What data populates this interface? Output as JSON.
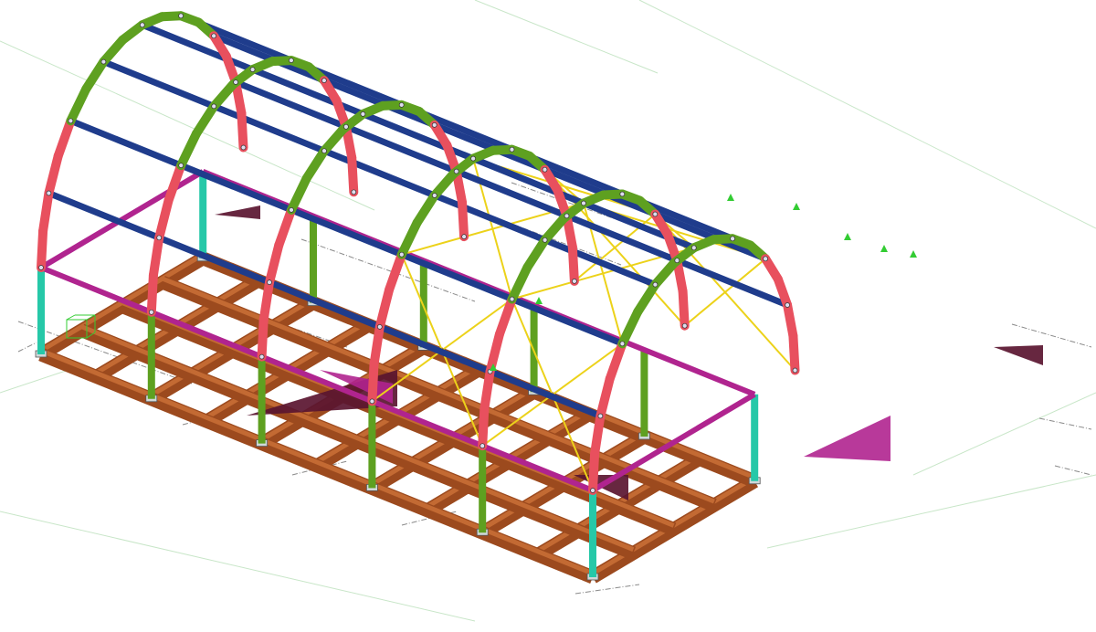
{
  "model": {
    "view": "isometric",
    "palette": {
      "background": "#ffffff",
      "grid": "#c8e6c8",
      "dims": "#8a8a8a",
      "foundation": "#9c4a1e",
      "foundation_top": "#c36a33",
      "ring_beam": "#b0248f",
      "column_corner": "#26c8a8",
      "column_mid": "#5ea020",
      "arch_red": "#e8505e",
      "arch_green": "#5ea020",
      "purlin": "#1f3c8c",
      "bracing": "#ecd21a",
      "plate": "#d0d8d8",
      "load_dark": "#5a1530",
      "load_mag": "#b0248f",
      "support": "#33cc33"
    },
    "legend": []
  }
}
